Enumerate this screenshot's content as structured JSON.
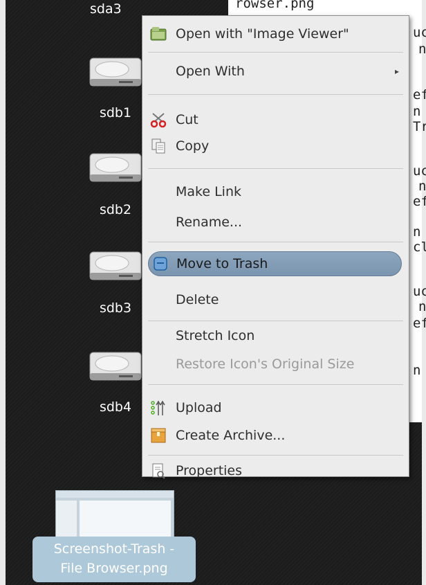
{
  "desktop": {
    "top_label": "sda3",
    "drives": [
      {
        "label": "sdb1"
      },
      {
        "label": "sdb2"
      },
      {
        "label": "sdb3"
      },
      {
        "label": "sdb4"
      }
    ],
    "file_label_line1": "Screenshot-Trash -",
    "file_label_line2": "File Browser.png"
  },
  "background_window": {
    "title_fragment": "rowser.png",
    "line_fragments": [
      "uc",
      "n",
      "ef",
      "n",
      "Tr",
      "uc",
      "n",
      "ef",
      "n",
      "cl",
      "uc",
      "n",
      "ef",
      "n"
    ]
  },
  "menu": {
    "items": [
      {
        "label": "Open with \"Image Viewer\"",
        "icon": "image-viewer-icon"
      },
      {
        "label": "Open With",
        "icon": "",
        "has_submenu": true
      },
      {
        "label": "Cut",
        "icon": "scissors-icon"
      },
      {
        "label": "Copy",
        "icon": "copy-icon"
      },
      {
        "label": "Make Link",
        "icon": ""
      },
      {
        "label": "Rename...",
        "icon": ""
      },
      {
        "label": "Move to Trash",
        "icon": "trash-icon",
        "active": true
      },
      {
        "label": "Delete",
        "icon": ""
      },
      {
        "label": "Stretch Icon",
        "icon": ""
      },
      {
        "label": "Restore Icon's Original Size",
        "icon": "",
        "disabled": true
      },
      {
        "label": "Upload",
        "icon": "upload-icon"
      },
      {
        "label": "Create Archive...",
        "icon": "archive-icon"
      },
      {
        "label": "Properties",
        "icon": "properties-icon"
      }
    ],
    "submenu_arrow": "▸",
    "active_color": "#7f99b4"
  }
}
